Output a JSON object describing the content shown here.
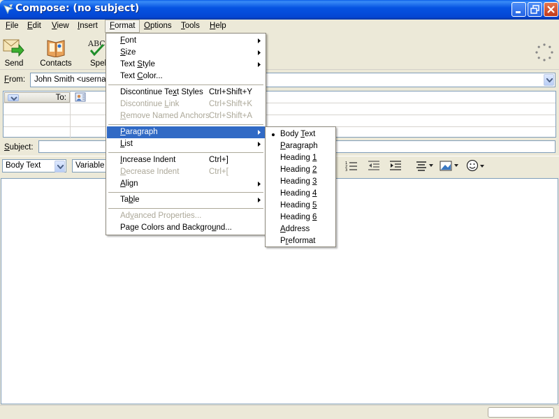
{
  "window": {
    "title": "Compose: (no subject)"
  },
  "menubar": [
    {
      "label": "File",
      "u": "F",
      "rest": "ile"
    },
    {
      "label": "Edit",
      "u": "E",
      "rest": "dit"
    },
    {
      "label": "View",
      "u": "V",
      "rest": "iew"
    },
    {
      "label": "Insert",
      "u": "I",
      "rest": "nsert"
    },
    {
      "label": "Format",
      "u": "F",
      "rest": "ormat"
    },
    {
      "label": "Options",
      "u": "O",
      "rest": "ptions"
    },
    {
      "label": "Tools",
      "u": "T",
      "rest": "ools"
    },
    {
      "label": "Help",
      "u": "H",
      "rest": "elp"
    }
  ],
  "toolbar": {
    "send": "Send",
    "contacts": "Contacts",
    "spell": "Spel"
  },
  "from": {
    "label": "From:",
    "u": "F",
    "rest": "rom:",
    "value": "John Smith <usernan"
  },
  "addressing": {
    "type_label": "To:"
  },
  "subject": {
    "label": "Subject:",
    "u": "S",
    "rest": "ubject:"
  },
  "format_toolbar": {
    "paragraph_style": "Body Text",
    "font": "Variable"
  },
  "format_menu": {
    "font": {
      "pre": "",
      "u": "F",
      "post": "ont"
    },
    "size": {
      "pre": "",
      "u": "S",
      "post": "ize"
    },
    "text_style": {
      "pre": "Text ",
      "u": "S",
      "post": "tyle"
    },
    "text_color": {
      "pre": "Text ",
      "u": "C",
      "post": "olor..."
    },
    "discontinue_text_styles": {
      "pre": "Discontinue Te",
      "u": "x",
      "post": "t Styles",
      "accel": "Ctrl+Shift+Y"
    },
    "discontinue_link": {
      "pre": "Discontinue ",
      "u": "L",
      "post": "ink",
      "accel": "Ctrl+Shift+K"
    },
    "remove_named_anchors": {
      "pre": "",
      "u": "R",
      "post": "emove Named Anchors",
      "accel": "Ctrl+Shift+A"
    },
    "paragraph": {
      "pre": "",
      "u": "P",
      "post": "aragraph"
    },
    "list": {
      "pre": "",
      "u": "L",
      "post": "ist"
    },
    "increase_indent": {
      "pre": "",
      "u": "I",
      "post": "ncrease Indent",
      "accel": "Ctrl+]"
    },
    "decrease_indent": {
      "pre": "",
      "u": "D",
      "post": "ecrease Indent",
      "accel": "Ctrl+["
    },
    "align": {
      "pre": "",
      "u": "A",
      "post": "lign"
    },
    "table": {
      "pre": "Ta",
      "u": "b",
      "post": "le"
    },
    "advanced_properties": {
      "pre": "Ad",
      "u": "v",
      "post": "anced Properties..."
    },
    "page_colors": {
      "pre": "Page Colors and Backgro",
      "u": "u",
      "post": "nd..."
    }
  },
  "paragraph_menu": {
    "body_text": {
      "pre": "Body ",
      "u": "T",
      "post": "ext"
    },
    "paragraph": {
      "pre": "",
      "u": "P",
      "post": "aragraph"
    },
    "heading1": {
      "pre": "Heading ",
      "u": "1",
      "post": ""
    },
    "heading2": {
      "pre": "Heading ",
      "u": "2",
      "post": ""
    },
    "heading3": {
      "pre": "Heading ",
      "u": "3",
      "post": ""
    },
    "heading4": {
      "pre": "Heading ",
      "u": "4",
      "post": ""
    },
    "heading5": {
      "pre": "Heading ",
      "u": "5",
      "post": ""
    },
    "heading6": {
      "pre": "Heading ",
      "u": "6",
      "post": ""
    },
    "address": {
      "pre": "",
      "u": "A",
      "post": "ddress"
    },
    "preformat": {
      "pre": "P",
      "u": "r",
      "post": "eformat"
    }
  },
  "colors": {
    "title_bar": "#0553e2",
    "menu_highlight": "#316ac5",
    "disabled_text": "#aca899"
  },
  "icons": {
    "app": "compose-icon",
    "send": "send-icon",
    "contacts": "contacts-icon",
    "spell": "spell-icon",
    "throbber": "throbber-icon",
    "address_book": "address-book-icon"
  }
}
